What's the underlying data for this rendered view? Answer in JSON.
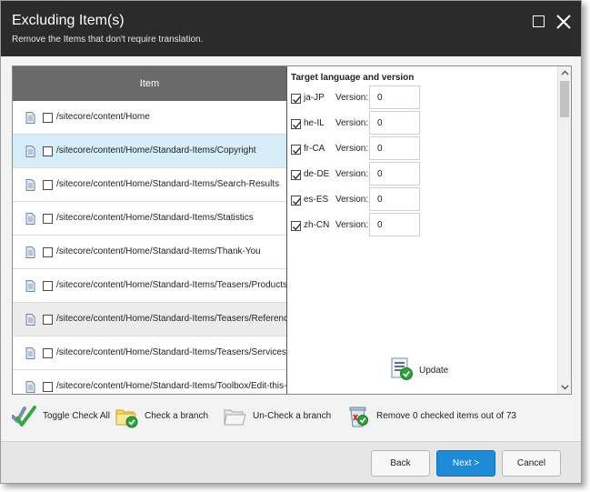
{
  "dialog": {
    "title": "Excluding Item(s)",
    "subtitle": "Remove the Items that don't require translation."
  },
  "items_header": "Item",
  "items": [
    {
      "path": "/sitecore/content/Home",
      "checked": false
    },
    {
      "path": "/sitecore/content/Home/Standard-Items/Copyright",
      "checked": false
    },
    {
      "path": "/sitecore/content/Home/Standard-Items/Search-Results",
      "checked": false
    },
    {
      "path": "/sitecore/content/Home/Standard-Items/Statistics",
      "checked": false
    },
    {
      "path": "/sitecore/content/Home/Standard-Items/Thank-You",
      "checked": false
    },
    {
      "path": "/sitecore/content/Home/Standard-Items/Teasers/Products",
      "checked": false
    },
    {
      "path": "/sitecore/content/Home/Standard-Items/Teasers/References",
      "checked": false
    },
    {
      "path": "/sitecore/content/Home/Standard-Items/Teasers/Services",
      "checked": false
    },
    {
      "path": "/sitecore/content/Home/Standard-Items/Toolbox/Edit-this-Site",
      "checked": false
    }
  ],
  "target": {
    "heading": "Target language and version",
    "version_label": "Version:",
    "languages": [
      {
        "code": "ja-JP",
        "version": "0",
        "checked": true
      },
      {
        "code": "he-IL",
        "version": "0",
        "checked": true
      },
      {
        "code": "fr-CA",
        "version": "0",
        "checked": true
      },
      {
        "code": "de-DE",
        "version": "0",
        "checked": true
      },
      {
        "code": "es-ES",
        "version": "0",
        "checked": true
      },
      {
        "code": "zh-CN",
        "version": "0",
        "checked": true
      }
    ],
    "update_label": "Update"
  },
  "toolbar": {
    "toggle_all": "Toggle Check All",
    "check_branch": "Check a branch",
    "uncheck_branch": "Un-Check a branch",
    "remove_checked": "Remove 0 checked items out of 73"
  },
  "footer": {
    "back": "Back",
    "next": "Next >",
    "cancel": "Cancel"
  },
  "colors": {
    "titlebar": "#2b2b2b",
    "selected_row": "#d6ecf7",
    "primary_button": "#1f8ad6"
  }
}
